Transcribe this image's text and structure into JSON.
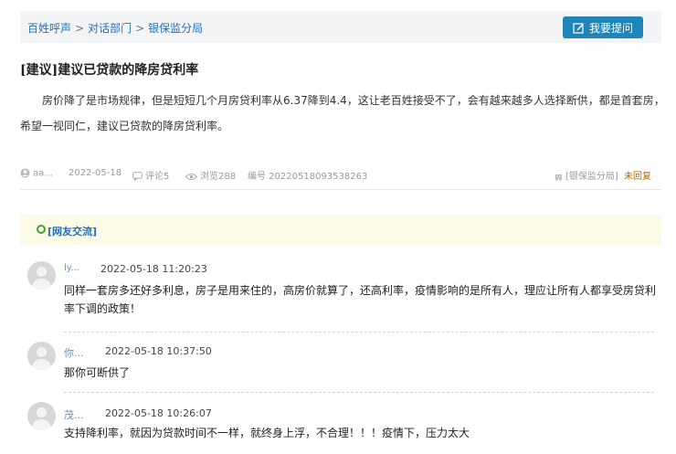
{
  "breadcrumb": {
    "items": [
      "百姓呼声",
      "对话部门",
      "银保监分局"
    ],
    "separator": ">"
  },
  "ask_button": {
    "label": "我要提问",
    "icon": "edit-icon",
    "color": "#1f84b8"
  },
  "post": {
    "title": "[建议]建议已贷款的降房贷利率",
    "content": "房价降了是市场规律，但是短短几个月房贷利率从6.37降到4.4，这让老百姓接受不了，会有越来越多人选择断供，都是首套房，希望一视同仁，建议已贷款的降房贷利率。",
    "meta": {
      "author": "aa...",
      "date": "2022-05-18",
      "comments": "评论5",
      "views": "浏览288",
      "number": "编号 20220518093538263",
      "department": "[银保监分局]",
      "status": "未回复"
    }
  },
  "comments_section": {
    "label": "[网友交流]",
    "items": [
      {
        "user": "ly...",
        "time": "2022-05-18 11:20:23",
        "text": "同样一套房多还好多利息，房子是用来住的，高房价就算了，还高利率，疫情影响的是所有人，理应让所有人都享受房贷利率下调的政策！"
      },
      {
        "user": "你...",
        "time": "2022-05-18 10:37:50",
        "text": "那你可断供了"
      },
      {
        "user": "茂...",
        "time": "2022-05-18 10:26:07",
        "text": "支持降利率，就因为贷款时间不一样，就终身上浮，不合理！！！疫情下，压力太大"
      }
    ]
  },
  "colors": {
    "link": "#2a6fb0",
    "status": "#b36a00",
    "comment_header_bg": "#fbfbe6"
  }
}
